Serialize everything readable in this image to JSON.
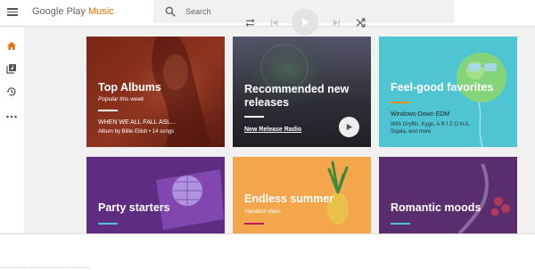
{
  "header": {
    "logo_prefix": "Google Play ",
    "logo_accent": "Music",
    "search_placeholder": "Search"
  },
  "rail": {
    "items": [
      "home-icon",
      "library-icon",
      "recents-icon",
      "more-icon"
    ],
    "active_color": "#ef6c00"
  },
  "cards": [
    {
      "title": "Top Albums",
      "subtitle": "Popular this week",
      "album": "WHEN WE ALL FALL ASL...",
      "meta": "Album by Billie Eilish • 14 songs"
    },
    {
      "title": "Recommended new releases",
      "link": "New Release Radio"
    },
    {
      "title": "Feel-good favorites",
      "line1": "Windows-Down EDM",
      "line2": "With Gryffin, Kygo, A R I Z O N A,",
      "line3": "Sigala, and more"
    },
    {
      "title": "Party starters"
    },
    {
      "title": "Endless summer",
      "subtitle": "Vacation days"
    },
    {
      "title": "Romantic moods"
    }
  ],
  "player": {
    "icons": [
      "repeat-icon",
      "previous-icon",
      "play-icon",
      "next-icon",
      "shuffle-icon"
    ]
  },
  "colors": {
    "accent": "#ef6c00",
    "card_top_albums": "#8a2f1c",
    "card_recommended": "#3f3f48",
    "card_feel_good": "#4fc5d3",
    "card_party": "#5e2d82",
    "card_summer": "#f4a64d",
    "card_romantic": "#5a2d6e"
  }
}
